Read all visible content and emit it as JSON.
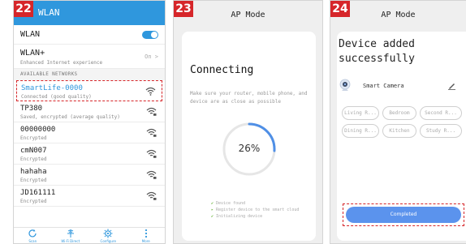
{
  "step_numbers": [
    "22",
    "23",
    "24"
  ],
  "wlan_screen": {
    "header_title": "WLAN",
    "wlan_label": "WLAN",
    "wlan_toggle_on": true,
    "wlan_plus_title": "WLAN+",
    "wlan_plus_subtitle": "Enhanced Internet experience",
    "wlan_plus_value": "On >",
    "section_header": "AVAILABLE NETWORKS",
    "networks": [
      {
        "name": "SmartLife-0000",
        "status": "Connected (good quality)",
        "selected": true
      },
      {
        "name": "TP380",
        "status": "Saved, encrypted (average quality)",
        "selected": false
      },
      {
        "name": "00000000",
        "status": "Encrypted",
        "selected": false
      },
      {
        "name": "cmN007",
        "status": "Encrypted",
        "selected": false
      },
      {
        "name": "hahaha",
        "status": "Encrypted",
        "selected": false
      },
      {
        "name": "JD161111",
        "status": "Encrypted",
        "selected": false
      }
    ],
    "bottom_nav": [
      {
        "label": "Scan",
        "icon": "refresh-icon"
      },
      {
        "label": "Wi-Fi Direct",
        "icon": "wifi-direct-icon"
      },
      {
        "label": "Configure",
        "icon": "gear-icon"
      },
      {
        "label": "More",
        "icon": "more-icon"
      }
    ],
    "accent_color": "#2f97dd",
    "highlight_color": "#d6262a"
  },
  "connecting_screen": {
    "header_title": "AP Mode",
    "title": "Connecting",
    "description": "Make sure your router, mobile phone, and device are as close as possible",
    "progress_percent": 26,
    "progress_label": "26%",
    "steps": [
      {
        "label": "Device found",
        "state": "done"
      },
      {
        "label": "Register device to the smart cloud",
        "state": "active"
      },
      {
        "label": "Initializing device",
        "state": "done"
      }
    ]
  },
  "added_screen": {
    "header_title": "AP Mode",
    "title": "Device added successfully",
    "device_name": "Smart Camera",
    "rooms": [
      "Living R...",
      "Bedroom",
      "Second R...",
      "Dining R...",
      "Kitchen",
      "Study R..."
    ],
    "completed_label": "Completed",
    "button_color": "#5b93ed"
  }
}
